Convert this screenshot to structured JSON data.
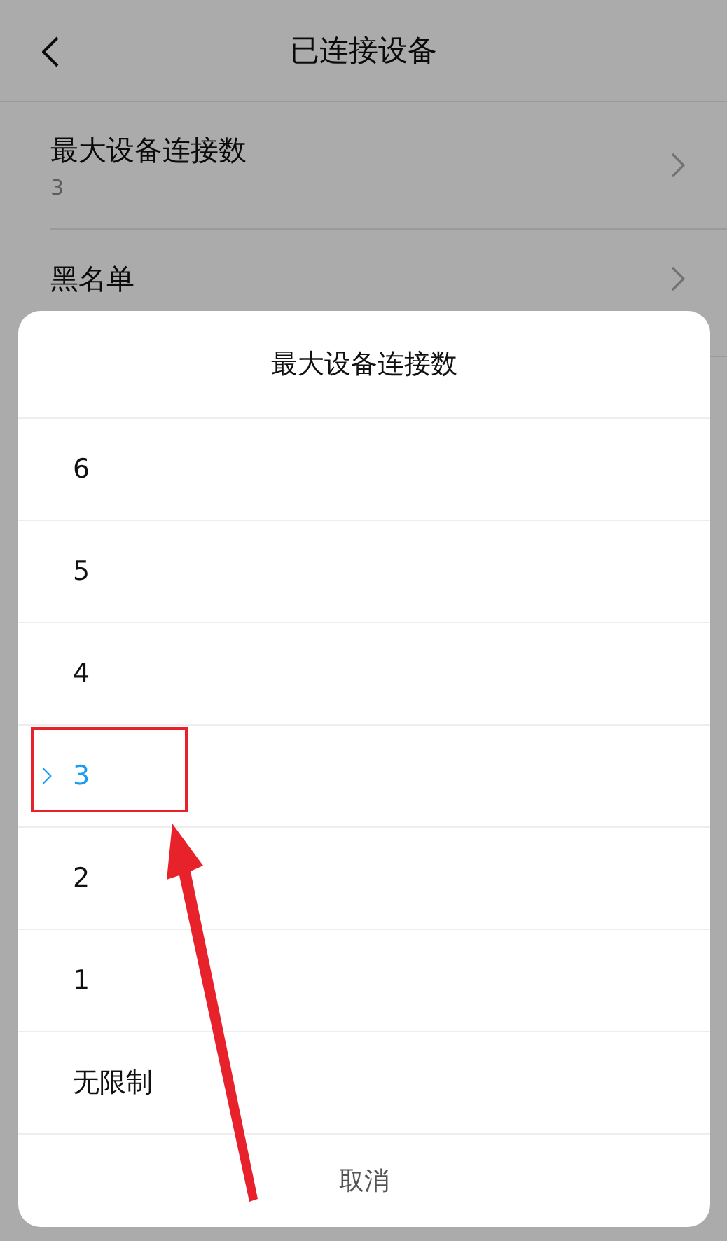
{
  "header": {
    "title": "已连接设备"
  },
  "settings": [
    {
      "title": "最大设备连接数",
      "subtitle": "3"
    },
    {
      "title": "黑名单"
    }
  ],
  "sheet": {
    "title": "最大设备连接数",
    "options": [
      {
        "label": "6",
        "selected": false
      },
      {
        "label": "5",
        "selected": false
      },
      {
        "label": "4",
        "selected": false
      },
      {
        "label": "3",
        "selected": true
      },
      {
        "label": "2",
        "selected": false
      },
      {
        "label": "1",
        "selected": false
      },
      {
        "label": "无限制",
        "selected": false
      }
    ],
    "cancel": "取消"
  }
}
